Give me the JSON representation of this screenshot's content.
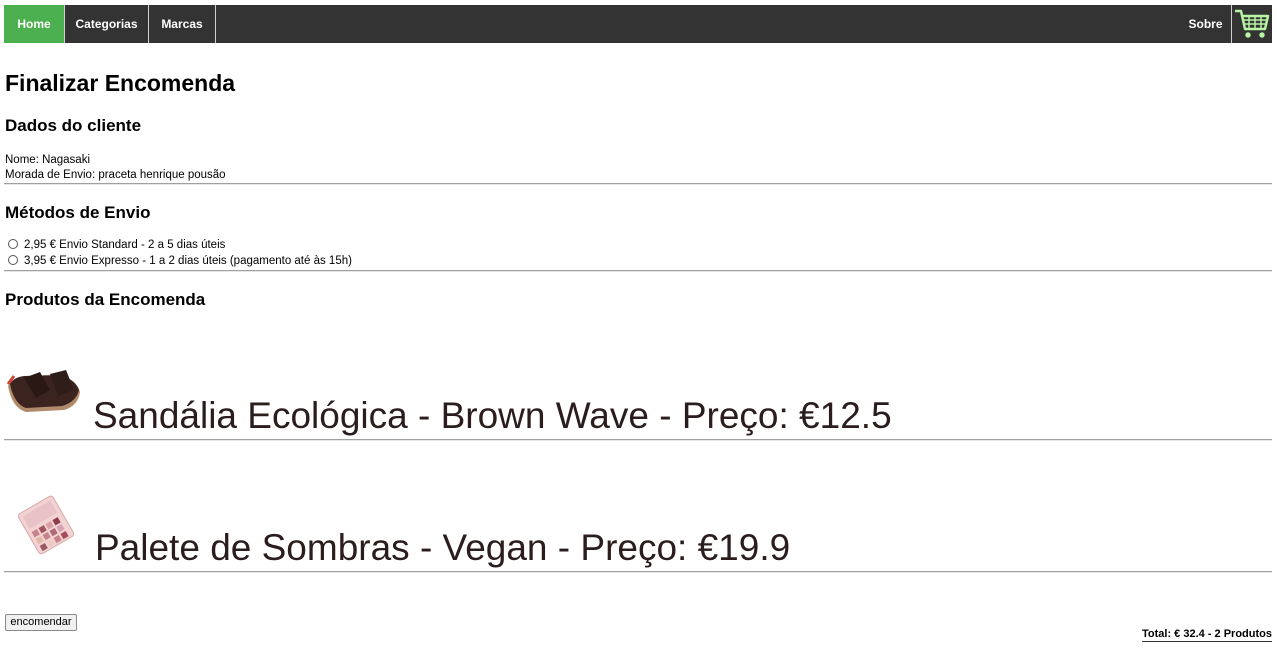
{
  "nav": {
    "home": "Home",
    "categorias": "Categorias",
    "marcas": "Marcas",
    "sobre": "Sobre",
    "cart_icon": "shopping-cart-icon",
    "accent_color": "#4caf50",
    "cart_color": "#b7f5a4"
  },
  "page_title": "Finalizar Encomenda",
  "cliente": {
    "heading": "Dados do cliente",
    "nome": "Nome: Nagasaki",
    "morada": "Morada de Envio: praceta henrique pousão"
  },
  "envio": {
    "heading": "Métodos de Envio",
    "options": [
      "2,95 € Envio Standard - 2 a 5 dias úteis",
      "3,95 € Envio Expresso - 1 a 2 dias úteis (pagamento até às 15h)"
    ]
  },
  "produtos": {
    "heading": "Produtos da Encomenda",
    "items": [
      {
        "label": "Sandália Ecológica - Brown Wave - Preço: €12.5",
        "image": "sandal-image"
      },
      {
        "label": "Palete de Sombras - Vegan - Preço: €19.9",
        "image": "eyeshadow-palette-image"
      }
    ]
  },
  "order_button": "encomendar",
  "total": "Total: € 32.4 - 2 Produtos"
}
